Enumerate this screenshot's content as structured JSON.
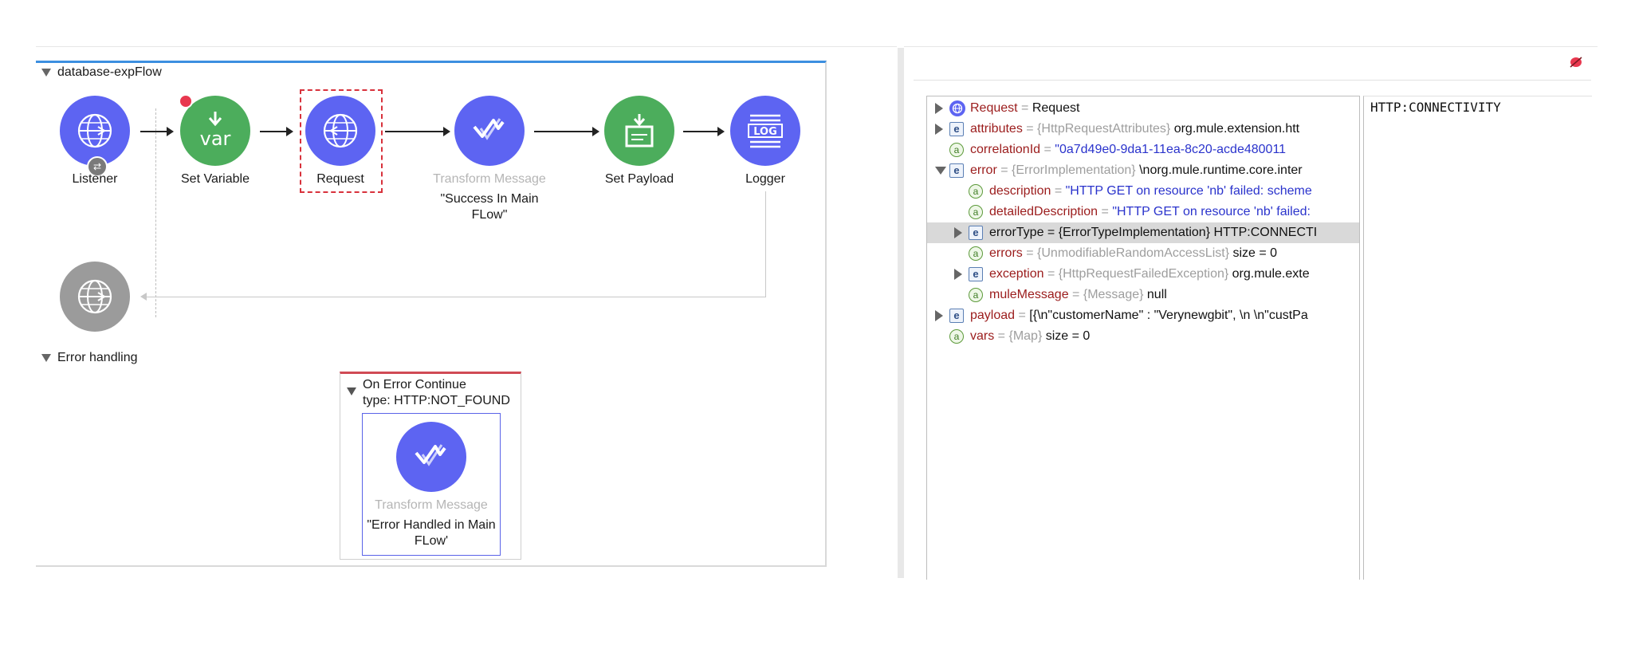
{
  "flow": {
    "title": "database-expFlow",
    "nodes": [
      {
        "label": "Listener",
        "color": "blue",
        "icon": "globe-icon"
      },
      {
        "label": "Set Variable",
        "color": "green",
        "icon": "var-icon"
      },
      {
        "label": "Request",
        "color": "blue",
        "icon": "globe-request-icon",
        "selected": true
      },
      {
        "label": "Transform Message",
        "sublabel": "\"Success In Main FLow\"",
        "color": "blue",
        "icon": "transform-icon"
      },
      {
        "label": "Set Payload",
        "color": "green",
        "icon": "payload-icon"
      },
      {
        "label": "Logger",
        "color": "blue",
        "icon": "log-icon"
      }
    ],
    "source_icon": "globe-grey-icon",
    "log_text": "LOG",
    "var_text": "var"
  },
  "error_handling": {
    "title": "Error handling",
    "scope_title": "On Error Continue",
    "scope_type": "type: HTTP:NOT_FOUND",
    "node_label": "Transform Message",
    "node_sublabel": "\"Error Handled in Main FLow'"
  },
  "debugger": {
    "rows": [
      {
        "indent": 0,
        "expand": "right",
        "icon": "request",
        "key": "Request",
        "eq": "=",
        "type": "",
        "value": "Request",
        "value_style": "v"
      },
      {
        "indent": 0,
        "expand": "right",
        "icon": "e",
        "key": "attributes",
        "eq": "=",
        "type": "{HttpRequestAttributes}",
        "value": "org.mule.extension.htt",
        "value_style": "v"
      },
      {
        "indent": 0,
        "expand": "",
        "icon": "a",
        "key": "correlationId",
        "eq": "=",
        "type": "",
        "value": "\"0a7d49e0-9da1-11ea-8c20-acde480011",
        "value_style": "s"
      },
      {
        "indent": 0,
        "expand": "down",
        "icon": "e",
        "key": "error",
        "eq": "=",
        "type": "{ErrorImplementation}",
        "value": "\\norg.mule.runtime.core.inter",
        "value_style": "v"
      },
      {
        "indent": 1,
        "expand": "",
        "icon": "a",
        "key": "description",
        "eq": "=",
        "type": "",
        "value": "\"HTTP GET on resource 'nb' failed: scheme",
        "value_style": "s"
      },
      {
        "indent": 1,
        "expand": "",
        "icon": "a",
        "key": "detailedDescription",
        "eq": "=",
        "type": "",
        "value": "\"HTTP GET on resource 'nb' failed:",
        "value_style": "s"
      },
      {
        "indent": 1,
        "expand": "right",
        "icon": "e",
        "key": "errorType = {ErrorTypeImplementation} HTTP:CONNECTI",
        "eq": "",
        "type": "",
        "value": "",
        "value_style": "v",
        "selected": true
      },
      {
        "indent": 1,
        "expand": "",
        "icon": "a",
        "key": "errors",
        "eq": "=",
        "type": "{UnmodifiableRandomAccessList}",
        "value": "size = 0",
        "value_style": "v"
      },
      {
        "indent": 1,
        "expand": "right",
        "icon": "e",
        "key": "exception",
        "eq": "=",
        "type": "{HttpRequestFailedException}",
        "value": "org.mule.exte",
        "value_style": "v"
      },
      {
        "indent": 1,
        "expand": "",
        "icon": "a",
        "key": "muleMessage",
        "eq": "=",
        "type": "{Message}",
        "value": "null",
        "value_style": "v"
      },
      {
        "indent": 0,
        "expand": "right",
        "icon": "e",
        "key": "payload",
        "eq": "=",
        "type": "",
        "value": "[{\\n\"customerName\" : \"Verynewgbit\", \\n \\n\"custPa",
        "value_style": "v"
      },
      {
        "indent": 0,
        "expand": "",
        "icon": "a",
        "key": "vars",
        "eq": "=",
        "type": "{Map}",
        "value": "size = 0",
        "value_style": "v"
      }
    ],
    "detail_text": "HTTP:CONNECTIVITY",
    "icon_letters": {
      "e": "e",
      "a": "a"
    }
  },
  "colors": {
    "node_blue": "#5d64f2",
    "node_green": "#4cad5c",
    "node_grey": "#9b9b9b",
    "selection_dash": "#d8323c",
    "breakpoint": "#e8384f",
    "flow_border": "#3c8fe0"
  }
}
